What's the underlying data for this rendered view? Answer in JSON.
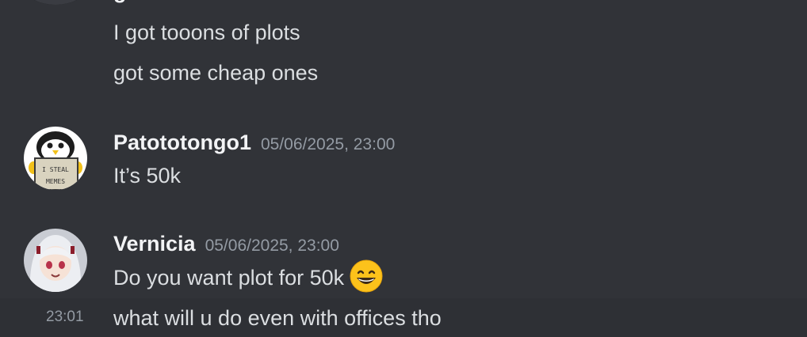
{
  "top_partial": {
    "username_fragment": "g"
  },
  "continuation_messages": [
    "I got tooons of plots",
    "got some cheap ones"
  ],
  "messages": [
    {
      "avatar_icon": "penguin-avatar-icon",
      "avatar_sign_line1": "I STEAL",
      "avatar_sign_line2": "MEMES",
      "username": "Patototongo1",
      "timestamp": "05/06/2025, 23:00",
      "lines": [
        "It’s 50k"
      ]
    },
    {
      "avatar_icon": "anime-girl-avatar-icon",
      "username": "Vernicia",
      "timestamp": "05/06/2025, 23:00",
      "lines": [
        "Do you want plot for 50k"
      ],
      "emoji": "grinning-smile-emoji"
    }
  ],
  "hovered_message": {
    "time": "23:01",
    "text": "what will u do even with offices tho"
  },
  "colors": {
    "background": "#313338",
    "hover_background": "#2e3035",
    "text": "#dbdee1",
    "username": "#f2f3f5",
    "muted": "#949ba4"
  }
}
